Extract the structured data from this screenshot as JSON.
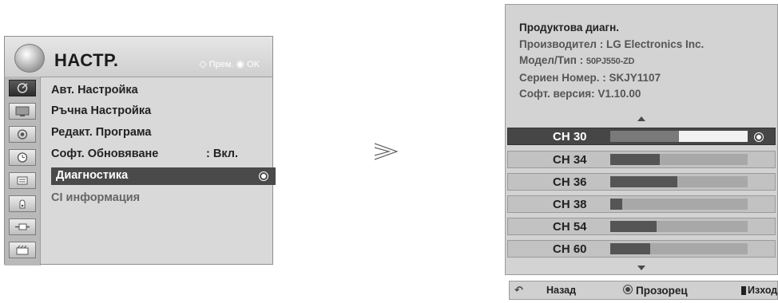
{
  "setup_menu": {
    "title": "НАСТР.",
    "hint_move": "Прем.",
    "hint_ok": "OK",
    "icons": [
      "satellite-dish-icon",
      "picture-icon",
      "audio-icon",
      "clock-icon",
      "lock-icon",
      "option-icon",
      "input-icon",
      "usb-icon"
    ],
    "items": [
      {
        "label": "Авт. Настройка",
        "value": ""
      },
      {
        "label": "Ръчна Настройка",
        "value": ""
      },
      {
        "label": "Редакт. Програма",
        "value": ""
      },
      {
        "label": "Софт. Обновяване",
        "value": ": Вкл."
      },
      {
        "label": "Диагностика",
        "value": "",
        "selected": true
      },
      {
        "label": "CI информация",
        "value": "",
        "disabled": true
      }
    ]
  },
  "diagnostics": {
    "title": "Продуктова диагн.",
    "manufacturer": "Производител : LG Electronics Inc.",
    "model_label": "Модел/Тип : ",
    "model_value": "50PJ550-ZD",
    "serial": "Сериен Номер. : SKJY1107",
    "software": "Софт. версия: V1.10.00",
    "channels": [
      {
        "name": "CH 30",
        "signal": 0.5,
        "selected": true
      },
      {
        "name": "CH 34",
        "signal": 0.36
      },
      {
        "name": "CH 36",
        "signal": 0.49
      },
      {
        "name": "CH 38",
        "signal": 0.09
      },
      {
        "name": "CH 54",
        "signal": 0.34
      },
      {
        "name": "CH 60",
        "signal": 0.29
      }
    ]
  },
  "footer": {
    "back": "Назад",
    "window": "Прозорец",
    "exit": "Изход"
  },
  "colors": {
    "menu_bg": "#d9d9d9",
    "selected_bg": "#4a4a4a",
    "signal_fill": "#555555",
    "signal_track": "#a8a8a8"
  }
}
